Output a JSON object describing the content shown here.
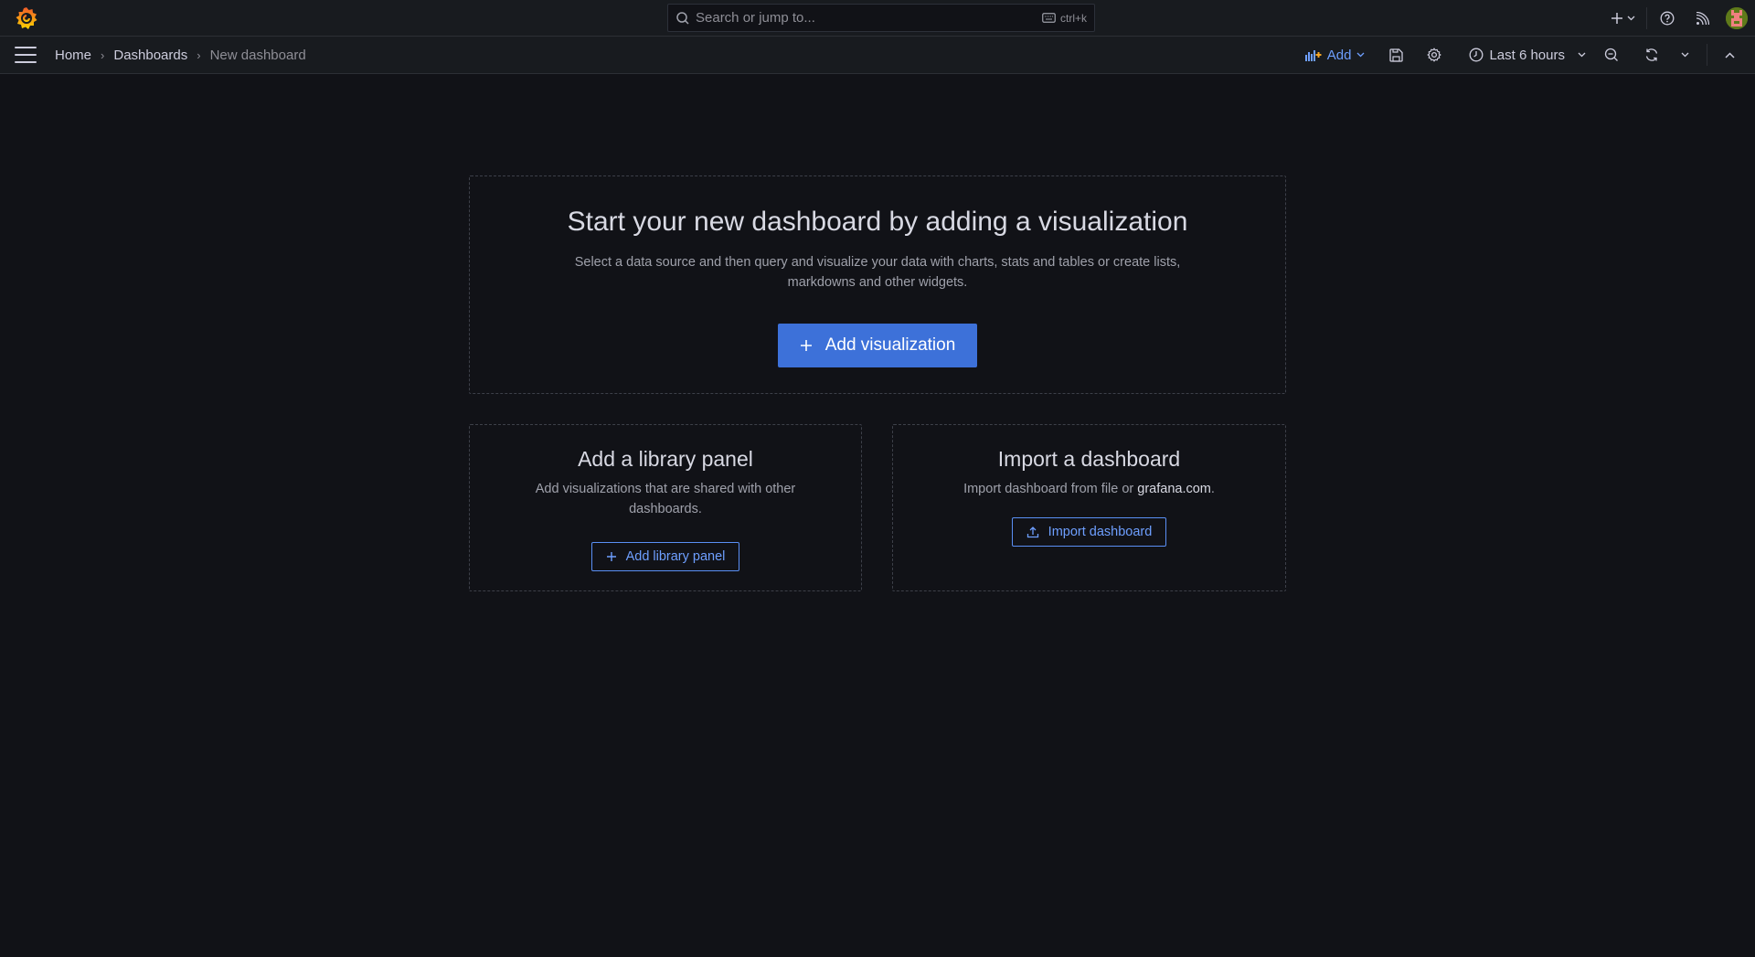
{
  "topbar": {
    "search": {
      "placeholder": "Search or jump to...",
      "shortcut": "ctrl+k"
    },
    "icons": [
      "grafana-logo",
      "plus-icon",
      "chevron-down-icon",
      "help-icon",
      "rss-icon",
      "avatar"
    ]
  },
  "navbar": {
    "breadcrumbs": [
      {
        "label": "Home"
      },
      {
        "label": "Dashboards"
      },
      {
        "label": "New dashboard"
      }
    ],
    "add_label": "Add",
    "time_range": "Last 6 hours",
    "colors": {
      "accent": "#6e9fff",
      "add_icon_plus": "#f5a623"
    }
  },
  "main": {
    "hero": {
      "title": "Start your new dashboard by adding a visualization",
      "description": "Select a data source and then query and visualize your data with charts, stats and tables or create lists, markdowns and other widgets.",
      "button": "Add visualization"
    },
    "library": {
      "title": "Add a library panel",
      "description": "Add visualizations that are shared with other dashboards.",
      "button": "Add library panel"
    },
    "import": {
      "title": "Import a dashboard",
      "description_prefix": "Import dashboard from file or ",
      "link": "grafana.com",
      "description_suffix": ".",
      "button": "Import dashboard"
    },
    "colors": {
      "primary": "#3d71d9",
      "background": "#111217"
    }
  }
}
